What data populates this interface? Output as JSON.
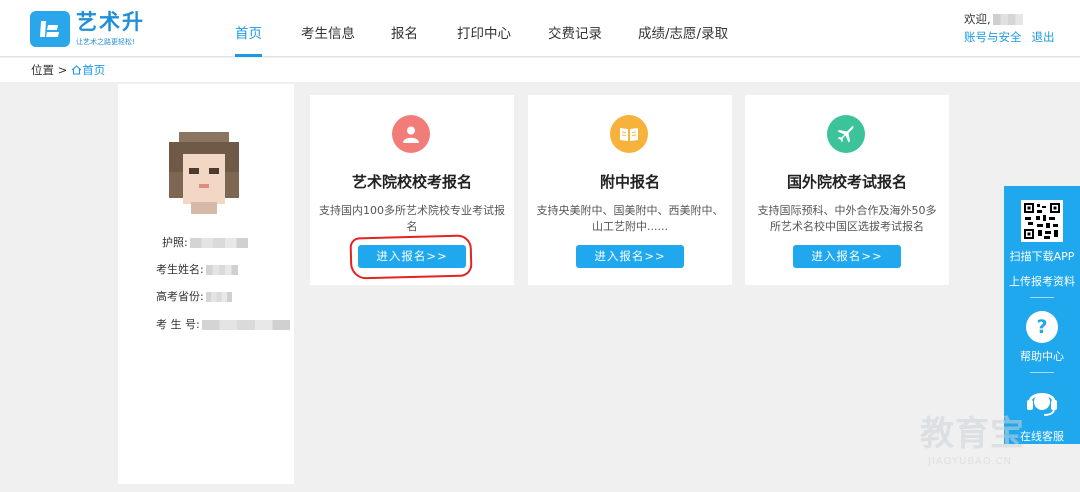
{
  "brand": {
    "name": "艺术升",
    "slogan": "让艺术之路更轻松!",
    "primary_color": "#1a9ae3"
  },
  "nav": {
    "items": [
      {
        "label": "首页",
        "active": true
      },
      {
        "label": "考生信息",
        "active": false
      },
      {
        "label": "报名",
        "active": false
      },
      {
        "label": "打印中心",
        "active": false
      },
      {
        "label": "交费记录",
        "active": false
      },
      {
        "label": "成绩/志愿/录取",
        "active": false
      }
    ]
  },
  "user": {
    "welcome": "欢迎,",
    "account_link": "账号与安全",
    "logout_link": "退出"
  },
  "breadcrumb": {
    "prefix": "位置 >",
    "home": "首页"
  },
  "profile": {
    "passport_label": "护照:",
    "name_label": "考生姓名:",
    "province_label": "高考省份:",
    "exam_no_label": "考 生 号:"
  },
  "cards": [
    {
      "title": "艺术院校校考报名",
      "desc": "支持国内100多所艺术院校专业考试报名",
      "button": "进入报名>>",
      "icon": "person-icon",
      "color": "#f27d78"
    },
    {
      "title": "附中报名",
      "desc": "支持央美附中、国美附中、西美附中、山工艺附中......",
      "button": "进入报名>>",
      "icon": "book-icon",
      "color": "#f6b23a"
    },
    {
      "title": "国外院校考试报名",
      "desc": "支持国际预科、中外合作及海外50多所艺术名校中国区选拔考试报名",
      "button": "进入报名>>",
      "icon": "airplane-icon",
      "color": "#3cc39a"
    }
  ],
  "sidebar": {
    "scan_app": "扫描下载APP",
    "upload": "上传报考资料",
    "help": "帮助中心",
    "service": "在线客服",
    "help_glyph": "?"
  },
  "watermark": {
    "text": "教育宝",
    "sub": "JIAOYUBAO.CN"
  }
}
